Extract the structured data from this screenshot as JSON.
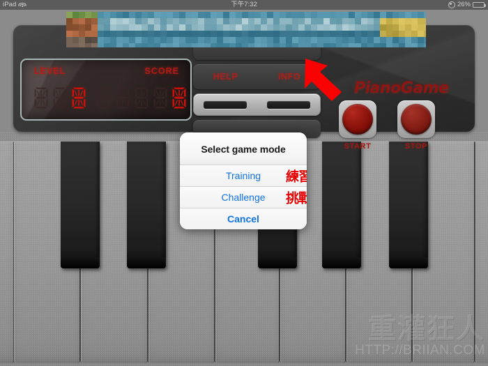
{
  "statusbar": {
    "device": "iPad",
    "wifi_icon": "wifi-icon",
    "time": "下午7:32",
    "location_icon": "location-services-icon",
    "battery_percent": "26%",
    "battery_level": 26
  },
  "game": {
    "title": "PianoGame",
    "display": {
      "level_label": "LEVEL",
      "score_label": "SCORE",
      "level_digits": [
        "",
        "",
        "0"
      ],
      "score_digits": [
        "",
        "",
        "",
        "",
        "0"
      ]
    },
    "buttons": {
      "help_label": "HELP",
      "info_label": "INFO",
      "start_label": "START",
      "stop_label": "STOP"
    },
    "colors": {
      "led_red": "#b31b14",
      "logo_red": "#8e1512",
      "button_red": "#9e1d14",
      "alert_blue": "#1073e8",
      "annotation_red": "#e90000"
    }
  },
  "banner": {
    "name": "censored-ad-banner",
    "state": "pixelated"
  },
  "alert": {
    "title": "Select game mode",
    "options": [
      {
        "label": "Training",
        "annotation": "練習"
      },
      {
        "label": "Challenge",
        "annotation": "挑戰"
      },
      {
        "label": "Cancel",
        "annotation": ""
      }
    ]
  },
  "annotation": {
    "arrow": "red-arrow-pointing-to-start-button"
  },
  "watermark": {
    "cn": "重灌狂人",
    "url": "HTTP://BRIIAN.COM"
  },
  "keyboard": {
    "white_key_count": 8,
    "black_key_count": 5
  }
}
